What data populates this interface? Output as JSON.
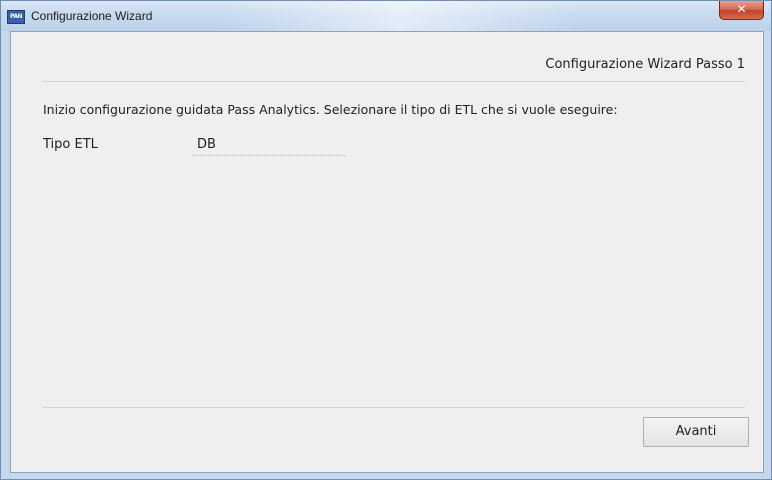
{
  "window": {
    "title": "Configurazione Wizard",
    "app_icon_text": "PAN",
    "close_glyph": "✕"
  },
  "wizard": {
    "step_title": "Configurazione Wizard Passo 1",
    "intro": "Inizio configurazione guidata Pass Analytics. Selezionare il tipo di ETL che si vuole eseguire:",
    "fields": [
      {
        "label": "Tipo ETL",
        "value": "DB"
      }
    ],
    "next_label": "Avanti"
  },
  "icons": [
    "app-icon",
    "close-icon"
  ],
  "colors": {
    "titlebar": "#c9dbef",
    "close_button": "#c2412a",
    "content_bg": "#efefef"
  }
}
